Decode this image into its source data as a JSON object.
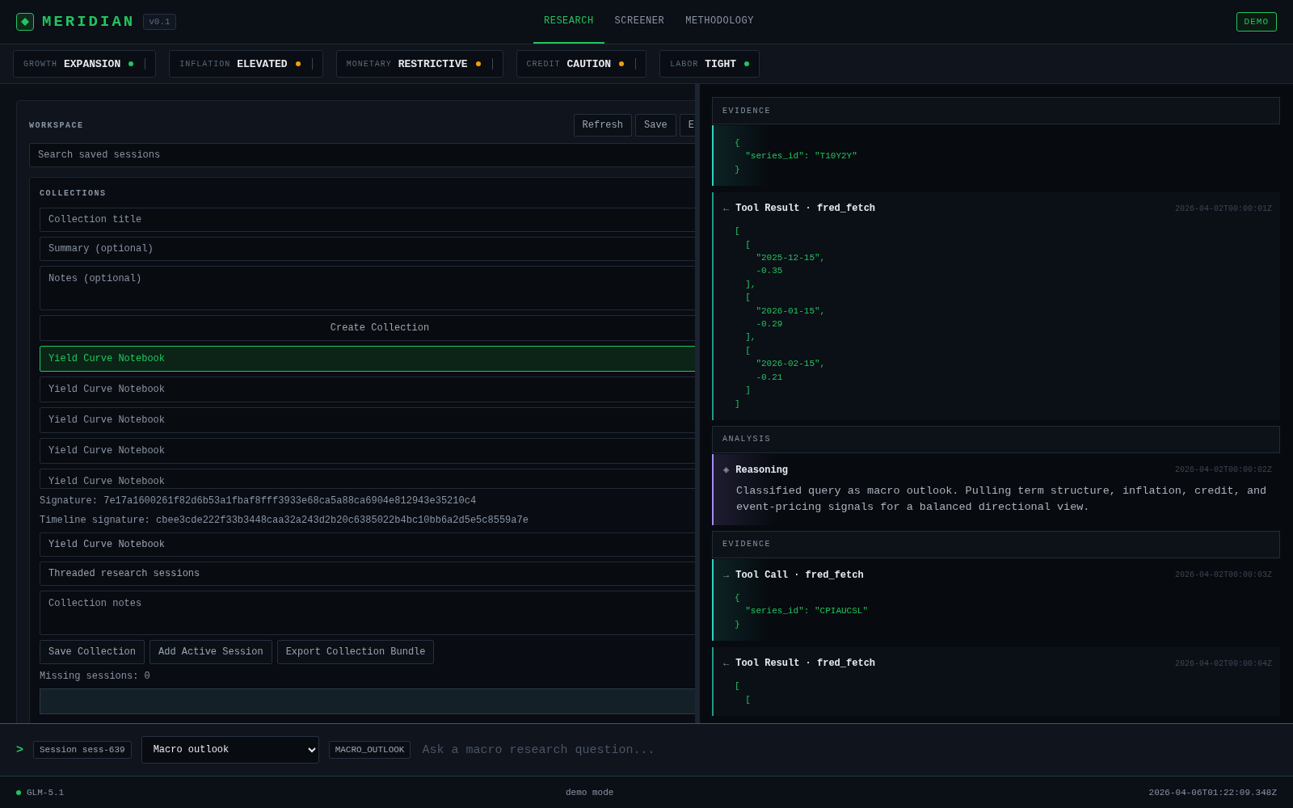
{
  "brand": {
    "name": "MERIDIAN",
    "version": "v0.1"
  },
  "nav": [
    {
      "label": "RESEARCH",
      "selected": true
    },
    {
      "label": "SCREENER",
      "selected": false
    },
    {
      "label": "METHODOLOGY",
      "selected": false
    }
  ],
  "mode_badge": "DEMO",
  "regimes": [
    {
      "label": "GROWTH",
      "value": "EXPANSION",
      "color": "#22c55e"
    },
    {
      "label": "INFLATION",
      "value": "ELEVATED",
      "color": "#f59e0b"
    },
    {
      "label": "MONETARY",
      "value": "RESTRICTIVE",
      "color": "#f59e0b"
    },
    {
      "label": "CREDIT",
      "value": "CAUTION",
      "color": "#f59e0b"
    },
    {
      "label": "LABOR",
      "value": "TIGHT",
      "color": "#22c55e"
    }
  ],
  "workspace": {
    "title": "WORKSPACE",
    "buttons": [
      "Refresh",
      "Save",
      "E"
    ],
    "search": {
      "placeholder": "Search saved sessions"
    },
    "collections": {
      "title": "COLLECTIONS",
      "title_field": {
        "placeholder": "Collection title"
      },
      "summary_field": {
        "placeholder": "Summary (optional)"
      },
      "notes_field": {
        "placeholder": "Notes (optional)"
      },
      "create_button": "Create Collection",
      "items": [
        {
          "label": "Yield Curve Notebook",
          "selected": true
        },
        {
          "label": "Yield Curve Notebook",
          "selected": false
        },
        {
          "label": "Yield Curve Notebook",
          "selected": false
        },
        {
          "label": "Yield Curve Notebook",
          "selected": false
        },
        {
          "label": "Yield Curve Notebook",
          "selected": false
        }
      ],
      "signature": "Signature: 7e17a1600261f82d6b53a1fbaf8fff3933e68ca5a88ca6904e812943e35210c4",
      "timeline_signature": "Timeline signature: cbee3cde222f33b3448caa32a243d2b20c6385022b4bc10bb6a2d5e5c8559a7e",
      "edit_title": {
        "value": "Yield Curve Notebook"
      },
      "edit_summary": {
        "value": "Threaded research sessions"
      },
      "edit_notes": {
        "placeholder": "Collection notes"
      },
      "actions": [
        "Save Collection",
        "Add Active Session",
        "Export Collection Bundle"
      ],
      "missing": "Missing sessions: 0"
    }
  },
  "feed": [
    {
      "kind": "section",
      "label": "EVIDENCE"
    },
    {
      "kind": "tool_call",
      "code": [
        "{",
        "  \"series_id\": \"T10Y2Y\"",
        "}"
      ]
    },
    {
      "kind": "tool_result",
      "arrow": "←",
      "title": "Tool Result · fred_fetch",
      "time": "2026-04-02T00:00:01Z",
      "code": [
        "[",
        "  [",
        "    \"2025-12-15\",",
        "    -0.35",
        "  ],",
        "  [",
        "    \"2026-01-15\",",
        "    -0.29",
        "  ],",
        "  [",
        "    \"2026-02-15\",",
        "    -0.21",
        "  ]",
        "]"
      ]
    },
    {
      "kind": "section",
      "label": "ANALYSIS"
    },
    {
      "kind": "reasoning",
      "arrow": "◈",
      "title": "Reasoning",
      "time": "2026-04-02T00:00:02Z",
      "text": "Classified query as macro outlook. Pulling term structure, inflation, credit, and event-pricing signals for a balanced directional view."
    },
    {
      "kind": "section",
      "label": "EVIDENCE"
    },
    {
      "kind": "tool_call",
      "arrow": "→",
      "title": "Tool Call · fred_fetch",
      "time": "2026-04-02T00:00:03Z",
      "code": [
        "{",
        "  \"series_id\": \"CPIAUCSL\"",
        "}"
      ]
    },
    {
      "kind": "tool_result",
      "arrow": "←",
      "title": "Tool Result · fred_fetch",
      "time": "2026-04-02T00:00:04Z",
      "code": [
        "[",
        "  ["
      ]
    }
  ],
  "composer": {
    "prompt": ">",
    "session": "Session sess-639",
    "mode_select": "Macro outlook",
    "mode_tag": "MACRO_OUTLOOK",
    "input": {
      "placeholder": "Ask a macro research question..."
    }
  },
  "status_bar": {
    "model": "GLM-5.1",
    "mode": "demo mode",
    "timestamp": "2026-04-06T01:22:09.348Z"
  }
}
